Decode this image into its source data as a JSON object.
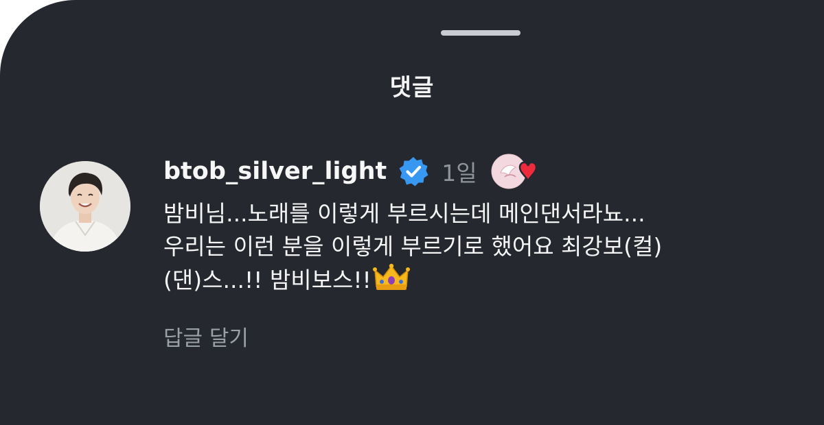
{
  "sheet": {
    "title": "댓글"
  },
  "comment": {
    "username": "btob_silver_light",
    "verified_icon": "verified-badge-icon",
    "time": "1일",
    "lines": [
      "밤비님...노래를 이렇게 부르시는데 메인댄서라뇨...",
      "우리는 이런 분을 이렇게 부르기로 했어요 최강보(컬)",
      "(댄)스...!! 밤비보스!!"
    ],
    "emoji": "crown-emoji",
    "reply_label": "답글 달기"
  },
  "colors": {
    "background": "#25282e",
    "verified": "#3897f0",
    "heart": "#ed2b3c",
    "muted_text": "#8f949c"
  }
}
